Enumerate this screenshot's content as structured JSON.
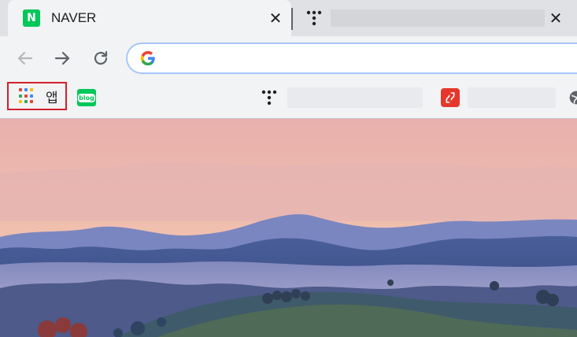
{
  "tabs": [
    {
      "title": "NAVER",
      "favicon_text": "N",
      "favicon_color": "#03c75a",
      "active": true
    },
    {
      "title": "",
      "active": false
    }
  ],
  "toolbar": {
    "back": "back-arrow-icon",
    "forward": "forward-arrow-icon",
    "reload": "reload-icon",
    "omnibox_value": "",
    "omnibox_icon": "google-g-icon"
  },
  "bookmarks": {
    "apps_label": "앱",
    "blog_text": "blog",
    "items": [
      "apps",
      "naver-blog",
      "dots-site",
      "red-app",
      "globe"
    ]
  },
  "colors": {
    "accent_highlight": "#d3202c",
    "naver_green": "#03c75a",
    "omnibox_focus": "#a8c7fa",
    "sky_top": "#e8a8a8",
    "mountain_blue": "#5a6fb0"
  }
}
